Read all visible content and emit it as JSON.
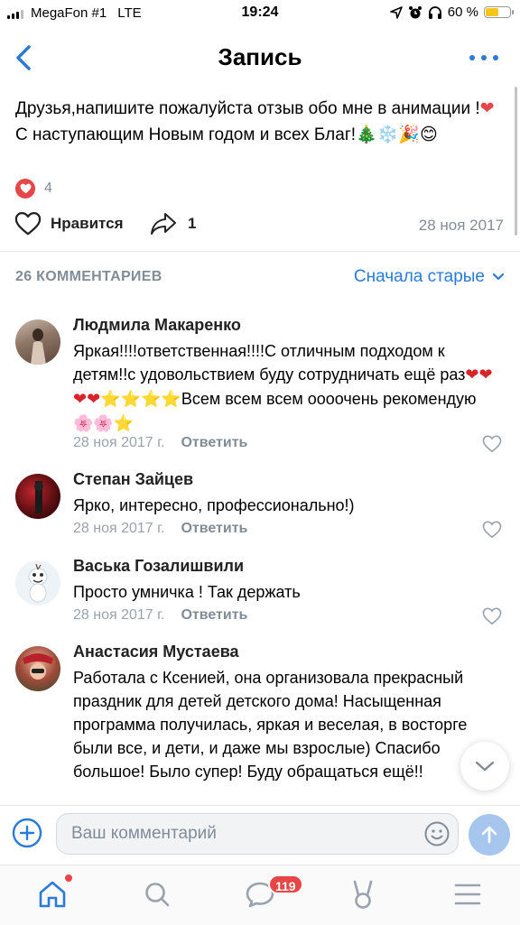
{
  "status_bar": {
    "carrier": "MegaFon #1",
    "network": "LTE",
    "time": "19:24",
    "battery": "60 %",
    "battery_level": 0.6
  },
  "header": {
    "title": "Запись"
  },
  "post": {
    "text_parts": [
      "Друзья,напишите пожалуйста отзыв обо мне в анимации !",
      "❤",
      "С наступающим Новым годом и всех Благ!",
      "🎄❄️🎉😊"
    ],
    "likes_count": "4",
    "like_label": "Нравится",
    "share_count": "1",
    "date": "28 ноя 2017"
  },
  "comments_header": {
    "count_label": "26 КОММЕНТАРИЕВ",
    "sort_label": "Сначала старые"
  },
  "comments": [
    {
      "name": "Людмила Макаренко",
      "text": "Яркая!!!!ответственная!!!!С отличным подходом к детям!!с удовольствием буду сотрудничать ещё раз",
      "emoji1": "❤❤❤❤",
      "emoji2": "⭐⭐⭐⭐",
      "text2": "Всем всем всем оооочень рекомендую ",
      "emoji3": "🌸🌸⭐",
      "date": "28 ноя 2017 г.",
      "reply": "Ответить"
    },
    {
      "name": "Степан Зайцев",
      "text": "Ярко, интересно, профессионально!)",
      "date": "28 ноя 2017 г.",
      "reply": "Ответить"
    },
    {
      "name": "Васька Гозалишвили",
      "text": "Просто умничка ! Так держать",
      "date": "28 ноя 2017 г.",
      "reply": "Ответить"
    },
    {
      "name": "Анастасия Мустаева",
      "text": "Работала с Ксенией, она организовала прекрасный праздник для детей детского дома! Насыщенная программа получилась, яркая и веселая, в восторге были все, и дети, и даже мы взрослые) Спасибо большое! Было супер! Буду обращаться ещё!!"
    }
  ],
  "composer": {
    "placeholder": "Ваш комментарий"
  },
  "tabbar": {
    "messages_badge": "119"
  },
  "colors": {
    "accent": "#2a7ad9",
    "like_red": "#e64646",
    "secondary_text": "#818c99"
  }
}
